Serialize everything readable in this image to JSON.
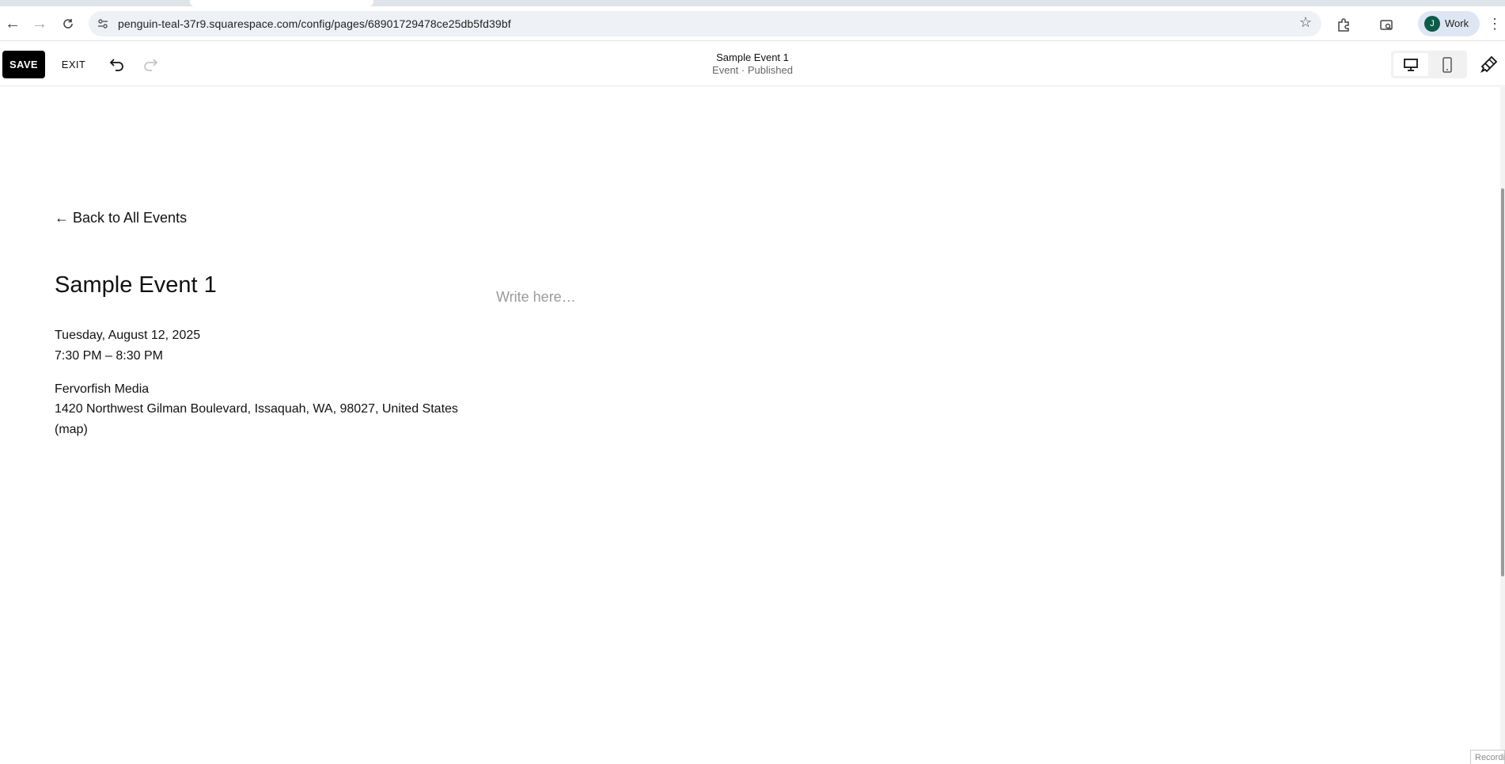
{
  "browser": {
    "url": "penguin-teal-37r9.squarespace.com/config/pages/68901729478ce25db5fd39bf",
    "profile_initial": "J",
    "profile_name": "Work"
  },
  "editor": {
    "save_label": "SAVE",
    "exit_label": "EXIT",
    "page_title": "Sample Event 1",
    "page_subtitle": "Event · Published"
  },
  "event": {
    "back_link": "← Back to All Events",
    "title": "Sample Event 1",
    "date": "Tuesday, August 12, 2025",
    "time": "7:30 PM – 8:30 PM",
    "venue": "Fervorfish Media",
    "address": "1420 Northwest Gilman Boulevard, Issaquah, WA, 98027, United States",
    "map_link": "(map)",
    "description_placeholder": "Write here…"
  },
  "overlay": {
    "recording_label": "Recording"
  }
}
